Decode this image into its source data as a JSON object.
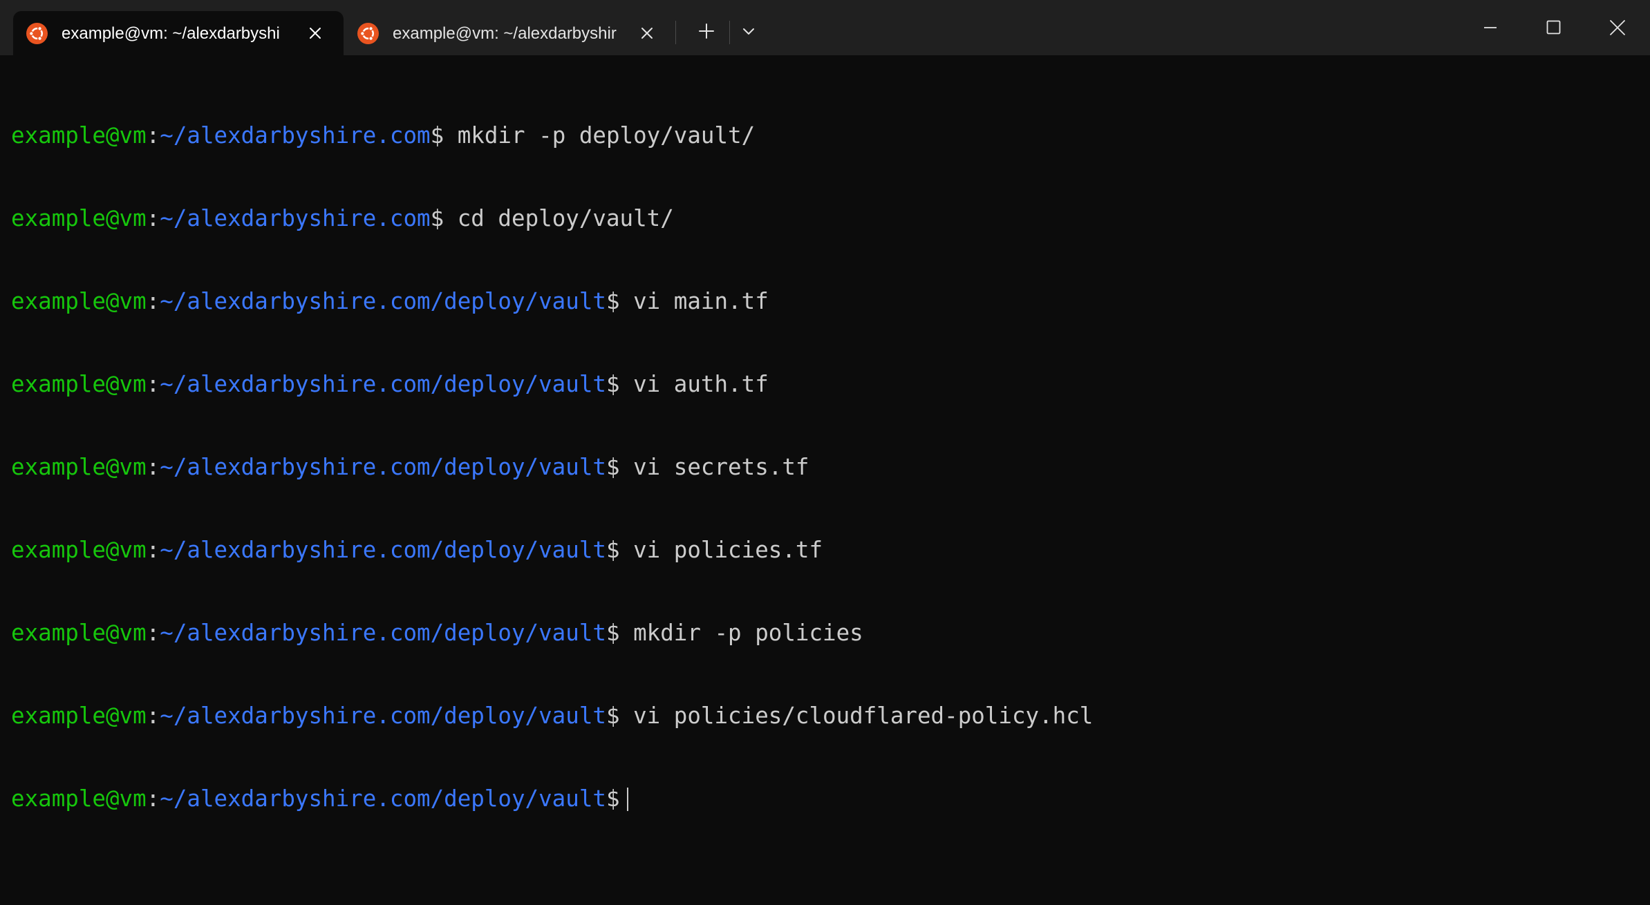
{
  "window": {
    "tabs": [
      {
        "title": "example@vm: ~/alexdarbyshi",
        "icon": "ubuntu-icon",
        "active": true
      },
      {
        "title": "example@vm: ~/alexdarbyshir",
        "icon": "ubuntu-icon",
        "active": false
      }
    ],
    "controls": {
      "new_tab_icon": "plus-icon",
      "dropdown_icon": "chevron-down-icon",
      "minimize_icon": "minimize-icon",
      "maximize_icon": "maximize-icon",
      "close_icon": "close-icon"
    }
  },
  "colors": {
    "background": "#0c0c0c",
    "titlebar": "#202020",
    "user": "#16c60c",
    "path": "#3b78ff",
    "text": "#cccccc",
    "ubuntu": "#e95420"
  },
  "terminal": {
    "lines": [
      {
        "user": "example@vm",
        "sep": ":",
        "path": "~/alexdarbyshire.com",
        "prompt": "$ ",
        "command": "mkdir -p deploy/vault/"
      },
      {
        "user": "example@vm",
        "sep": ":",
        "path": "~/alexdarbyshire.com",
        "prompt": "$ ",
        "command": "cd deploy/vault/"
      },
      {
        "user": "example@vm",
        "sep": ":",
        "path": "~/alexdarbyshire.com/deploy/vault",
        "prompt": "$ ",
        "command": "vi main.tf"
      },
      {
        "user": "example@vm",
        "sep": ":",
        "path": "~/alexdarbyshire.com/deploy/vault",
        "prompt": "$ ",
        "command": "vi auth.tf"
      },
      {
        "user": "example@vm",
        "sep": ":",
        "path": "~/alexdarbyshire.com/deploy/vault",
        "prompt": "$ ",
        "command": "vi secrets.tf"
      },
      {
        "user": "example@vm",
        "sep": ":",
        "path": "~/alexdarbyshire.com/deploy/vault",
        "prompt": "$ ",
        "command": "vi policies.tf"
      },
      {
        "user": "example@vm",
        "sep": ":",
        "path": "~/alexdarbyshire.com/deploy/vault",
        "prompt": "$ ",
        "command": "mkdir -p policies"
      },
      {
        "user": "example@vm",
        "sep": ":",
        "path": "~/alexdarbyshire.com/deploy/vault",
        "prompt": "$ ",
        "command": "vi policies/cloudflared-policy.hcl"
      },
      {
        "user": "example@vm",
        "sep": ":",
        "path": "~/alexdarbyshire.com/deploy/vault",
        "prompt": "$",
        "command": ""
      }
    ]
  }
}
